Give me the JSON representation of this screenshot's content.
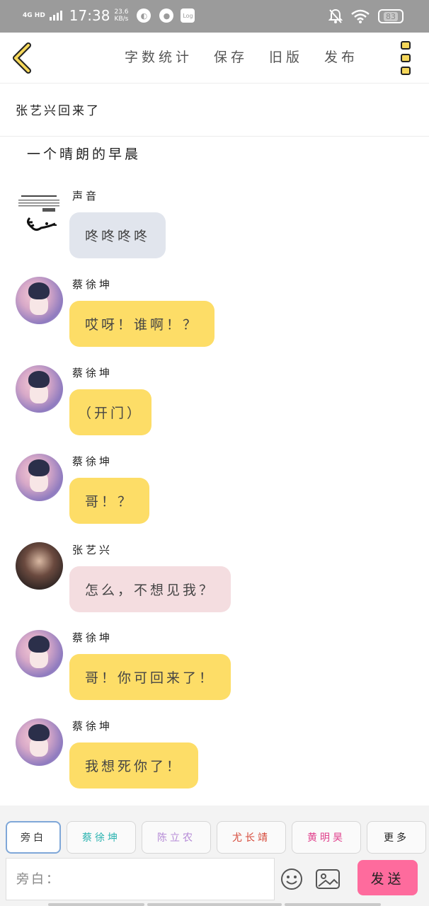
{
  "status_bar": {
    "network": "4G HD",
    "time": "17:38",
    "speed_value": "23.6",
    "speed_unit": "KB/s",
    "battery": "83",
    "log_label": "Log"
  },
  "toolbar": {
    "items": [
      "字数统计",
      "保存",
      "旧版",
      "发布"
    ]
  },
  "title": "张艺兴回来了",
  "narration": "一个晴朗的早晨",
  "messages": [
    {
      "sender": "声音",
      "text": "咚咚咚咚",
      "style": "gray",
      "avatar": "meme"
    },
    {
      "sender": "蔡徐坤",
      "text": "哎呀！谁啊！？",
      "style": "yellow",
      "avatar": "pink"
    },
    {
      "sender": "蔡徐坤",
      "text": "（开门）",
      "style": "yellow",
      "avatar": "pink"
    },
    {
      "sender": "蔡徐坤",
      "text": "哥！？",
      "style": "yellow",
      "avatar": "pink"
    },
    {
      "sender": "张艺兴",
      "text": "怎么，不想见我？",
      "style": "pinkb",
      "avatar": "dark"
    },
    {
      "sender": "蔡徐坤",
      "text": "哥！你可回来了！",
      "style": "yellow",
      "avatar": "pink"
    },
    {
      "sender": "蔡徐坤",
      "text": "我想死你了！",
      "style": "yellow",
      "avatar": "pink"
    }
  ],
  "roles": [
    {
      "label": "旁白",
      "color": "#555555"
    },
    {
      "label": "蔡徐坤",
      "color": "#2bb3b0"
    },
    {
      "label": "陈立农",
      "color": "#b58ad6"
    },
    {
      "label": "尤长靖",
      "color": "#d64a3a"
    },
    {
      "label": "黄明昊",
      "color": "#e0408c"
    },
    {
      "label": "更多",
      "color": "#555555"
    }
  ],
  "input": {
    "placeholder": "旁白："
  },
  "send_label": "发送",
  "colors": {
    "accent_yellow": "#fddd67",
    "send_pink": "#fe6b9d",
    "bubble_gray": "#e1e5ed",
    "bubble_pink": "#f4dde0"
  }
}
